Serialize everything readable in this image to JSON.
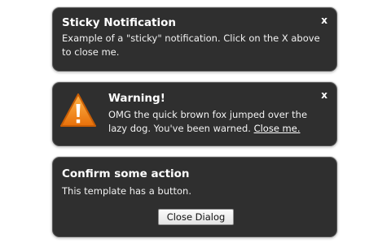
{
  "notifications": [
    {
      "title": "Sticky Notification",
      "body": "Example of a \"sticky\" notification. Click on the X above to close me.",
      "close_label": "x"
    },
    {
      "title": "Warning!",
      "body": "OMG the quick brown fox jumped over the lazy dog. You've been warned.",
      "link": "Close me.",
      "close_label": "x",
      "icon": "warning-icon"
    },
    {
      "title": "Confirm some action",
      "body": "This template has a button.",
      "button_label": "Close Dialog"
    }
  ],
  "colors": {
    "panel_bg": "#2f2f2f",
    "text": "#ffffff",
    "warning_orange": "#f58a12"
  }
}
